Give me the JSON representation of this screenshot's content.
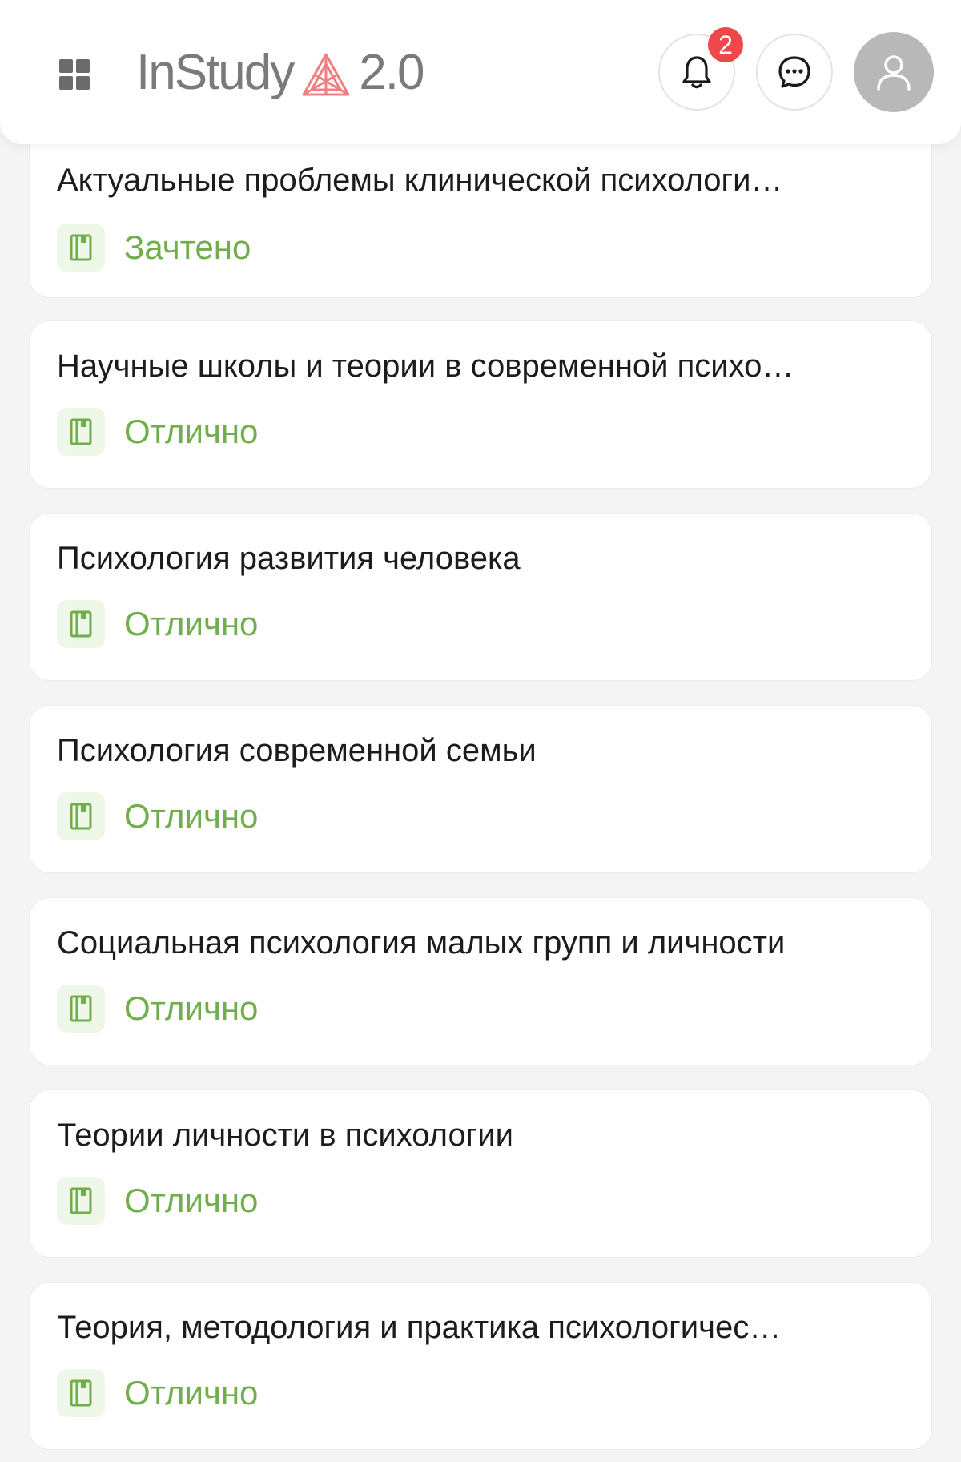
{
  "header": {
    "logo_text": "InStudy",
    "logo_version": "2.0",
    "notifications_count": "2",
    "colors": {
      "badge": "#f04848",
      "logo_mark": "#f08080",
      "grade_green": "#6fae4a"
    }
  },
  "icons": {
    "menu": "grid-icon",
    "notifications": "bell-icon",
    "messages": "chat-icon",
    "profile": "user-icon",
    "grade": "record-book-icon"
  },
  "courses": [
    {
      "title": "Актуальные проблемы клинической психологи…",
      "grade": "Зачтено"
    },
    {
      "title": "Научные школы и теории в современной психо…",
      "grade": "Отлично"
    },
    {
      "title": "Психология развития человека",
      "grade": "Отлично"
    },
    {
      "title": "Психология современной семьи",
      "grade": "Отлично"
    },
    {
      "title": "Социальная психология малых групп и личности",
      "grade": "Отлично"
    },
    {
      "title": "Теории личности в психологии",
      "grade": "Отлично"
    },
    {
      "title": "Теория, методология и практика психологичес…",
      "grade": "Отлично"
    }
  ]
}
